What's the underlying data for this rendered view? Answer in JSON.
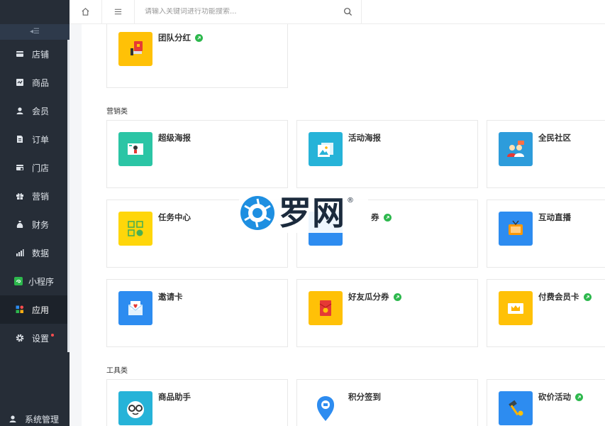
{
  "topbar": {
    "search_placeholder": "请输入关键词进行功能搜索..."
  },
  "sidebar": {
    "collapse_label": "◂☰",
    "items": [
      {
        "label": "店铺",
        "icon": "shop-icon"
      },
      {
        "label": "商品",
        "icon": "goods-icon"
      },
      {
        "label": "会员",
        "icon": "member-icon"
      },
      {
        "label": "订单",
        "icon": "order-icon"
      },
      {
        "label": "门店",
        "icon": "store-icon"
      },
      {
        "label": "营销",
        "icon": "gift-icon"
      },
      {
        "label": "财务",
        "icon": "finance-icon"
      },
      {
        "label": "数据",
        "icon": "chart-icon"
      },
      {
        "label": "小程序",
        "icon": "miniprogram-icon"
      },
      {
        "label": "应用",
        "icon": "apps-icon"
      },
      {
        "label": "设置",
        "icon": "gear-icon"
      }
    ],
    "bottom_label": "系统管理"
  },
  "sections": {
    "marketing": "营销类",
    "tools": "工具类"
  },
  "cards": {
    "team_bonus": "团队分红",
    "super_poster": "超级海报",
    "activity_poster": "活动海报",
    "community": "全民社区",
    "task_center": "任务中心",
    "hidden_card_suffix": "券",
    "live_stream": "互动直播",
    "invite_card": "邀请卡",
    "friend_coupon": "好友瓜分券",
    "paid_member": "付费会员卡",
    "goods_helper": "商品助手",
    "points_checkin": "积分签到",
    "bargain": "砍价活动"
  },
  "watermark": {
    "text": "罗网",
    "reg": "®"
  },
  "colors": {
    "sidebar_bg": "#262d37",
    "active_bg": "#1c222a",
    "link_green": "#2db84d",
    "notify_red": "#ff4d4f"
  }
}
